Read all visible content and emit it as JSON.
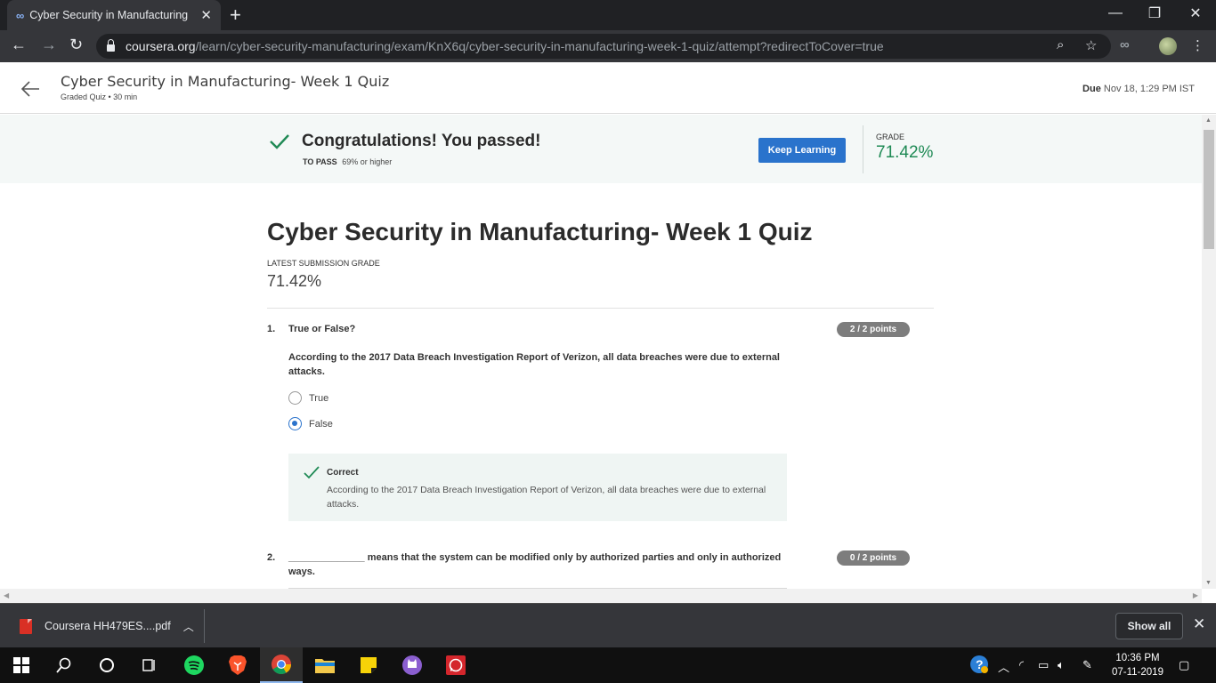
{
  "browser": {
    "tab_title": "Cyber Security in Manufacturing",
    "url_host": "coursera.org",
    "url_path": "/learn/cyber-security-manufacturing/exam/KnX6q/cyber-security-in-manufacturing-week-1-quiz/attempt?redirectToCover=true"
  },
  "header": {
    "title": "Cyber Security in Manufacturing- Week 1 Quiz",
    "meta": "Graded Quiz • 30 min",
    "due_label": "Due",
    "due_value": "Nov 18, 1:29 PM IST"
  },
  "banner": {
    "message": "Congratulations! You passed!",
    "to_pass_label": "TO PASS",
    "to_pass_value": "69% or higher",
    "button_label": "Keep Learning",
    "grade_label": "GRADE",
    "grade_value": "71.42%"
  },
  "main": {
    "title": "Cyber Security in Manufacturing- Week 1 Quiz",
    "latest_label": "LATEST SUBMISSION GRADE",
    "latest_value": "71.42%"
  },
  "questions": [
    {
      "number": "1.",
      "title": "True or False?",
      "prompt": "According to the 2017 Data Breach Investigation Report of Verizon, all data breaches were due to external attacks.",
      "points": "2 / 2 points",
      "options": [
        "True",
        "False"
      ],
      "selected": "False",
      "feedback_title": "Correct",
      "feedback_text": "According to the 2017 Data Breach Investigation Report of Verizon, all data breaches were due to external attacks."
    },
    {
      "number": "2.",
      "prompt": "______________ means that the system can be modified only by authorized parties and only in authorized ways.",
      "points": "0 / 2 points"
    }
  ],
  "downloads": {
    "file_name": "Coursera HH479ES....pdf",
    "show_all_label": "Show all"
  },
  "taskbar": {
    "time": "10:36 PM",
    "date": "07-11-2019"
  },
  "colors": {
    "accent_blue": "#2a73cc",
    "pass_green": "#1f8a55",
    "banner_bg": "#f4f8f7"
  }
}
